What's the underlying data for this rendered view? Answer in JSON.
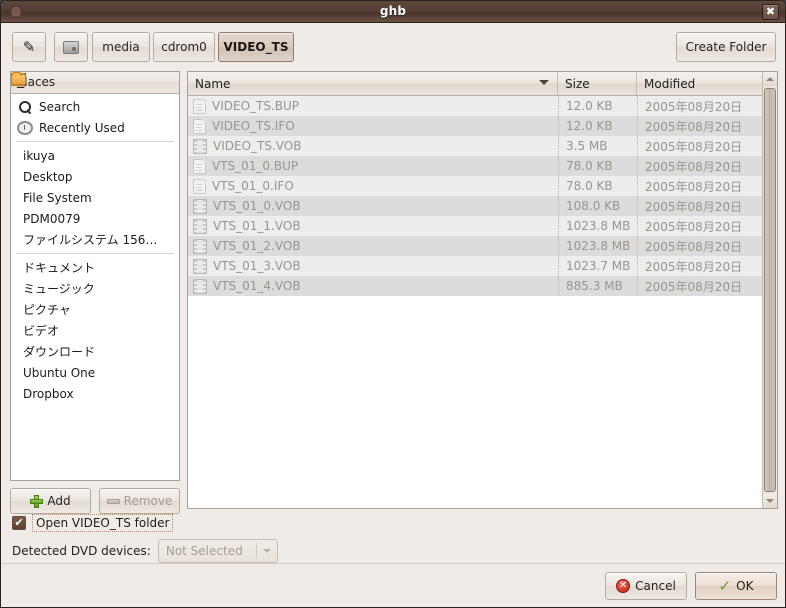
{
  "window": {
    "title": "ghb",
    "close_label": "✖"
  },
  "pathbar": {
    "edit_icon": "pencil-icon",
    "device_icon": "hard-disk-icon",
    "crumbs": [
      {
        "label": "media",
        "active": false
      },
      {
        "label": "cdrom0",
        "active": false
      },
      {
        "label": "VIDEO_TS",
        "active": true
      }
    ],
    "create_folder_label": "Create Folder"
  },
  "places": {
    "header": "Places",
    "groups": [
      [
        {
          "label": "Search",
          "icon": "search-icon"
        },
        {
          "label": "Recently Used",
          "icon": "clock-icon"
        }
      ],
      [
        {
          "label": "ikuya",
          "icon": "home-folder-icon"
        },
        {
          "label": "Desktop",
          "icon": "desktop-icon"
        },
        {
          "label": "File System",
          "icon": "hard-disk-icon"
        },
        {
          "label": "PDM0079",
          "icon": "cd-disc-icon"
        },
        {
          "label": "ファイルシステム 156…",
          "icon": "hard-disk-icon"
        }
      ],
      [
        {
          "label": "ドキュメント",
          "icon": "documents-folder-icon"
        },
        {
          "label": "ミュージック",
          "icon": "music-folder-icon"
        },
        {
          "label": "ピクチャ",
          "icon": "pictures-folder-icon"
        },
        {
          "label": "ビデオ",
          "icon": "videos-folder-icon"
        },
        {
          "label": "ダウンロード",
          "icon": "downloads-folder-icon"
        },
        {
          "label": "Ubuntu One",
          "icon": "folder-icon"
        },
        {
          "label": "Dropbox",
          "icon": "folder-icon"
        }
      ]
    ],
    "add_label": "Add",
    "remove_label": "Remove"
  },
  "filelist": {
    "columns": {
      "name": "Name",
      "size": "Size",
      "modified": "Modified"
    },
    "sort_column": "Name",
    "rows": [
      {
        "name": "VIDEO_TS.BUP",
        "size": "12.0 KB",
        "modified": "2005年08月20日",
        "icon": "file-icon"
      },
      {
        "name": "VIDEO_TS.IFO",
        "size": "12.0 KB",
        "modified": "2005年08月20日",
        "icon": "file-icon"
      },
      {
        "name": "VIDEO_TS.VOB",
        "size": "3.5 MB",
        "modified": "2005年08月20日",
        "icon": "film-icon"
      },
      {
        "name": "VTS_01_0.BUP",
        "size": "78.0 KB",
        "modified": "2005年08月20日",
        "icon": "file-icon"
      },
      {
        "name": "VTS_01_0.IFO",
        "size": "78.0 KB",
        "modified": "2005年08月20日",
        "icon": "file-icon"
      },
      {
        "name": "VTS_01_0.VOB",
        "size": "108.0 KB",
        "modified": "2005年08月20日",
        "icon": "film-icon"
      },
      {
        "name": "VTS_01_1.VOB",
        "size": "1023.8 MB",
        "modified": "2005年08月20日",
        "icon": "film-icon"
      },
      {
        "name": "VTS_01_2.VOB",
        "size": "1023.8 MB",
        "modified": "2005年08月20日",
        "icon": "film-icon"
      },
      {
        "name": "VTS_01_3.VOB",
        "size": "1023.7 MB",
        "modified": "2005年08月20日",
        "icon": "film-icon"
      },
      {
        "name": "VTS_01_4.VOB",
        "size": "885.3 MB",
        "modified": "2005年08月20日",
        "icon": "film-icon"
      }
    ]
  },
  "options": {
    "open_folder_label": "Open VIDEO_TS folder",
    "open_folder_checked": true,
    "check_glyph": "✔",
    "dvd_devices_label": "Detected DVD devices:",
    "dvd_devices_value": "Not Selected"
  },
  "actions": {
    "cancel_label": "Cancel",
    "ok_label": "OK",
    "cancel_glyph": "✕",
    "ok_glyph": "✓"
  },
  "colors": {
    "titlebar": "#553f35",
    "window_bg": "#efebe7",
    "row_odd": "#ededed",
    "row_even": "#dcdcdc",
    "accent_active_crumb": "#d5c9be",
    "checkbox_fill": "#5c4034"
  }
}
